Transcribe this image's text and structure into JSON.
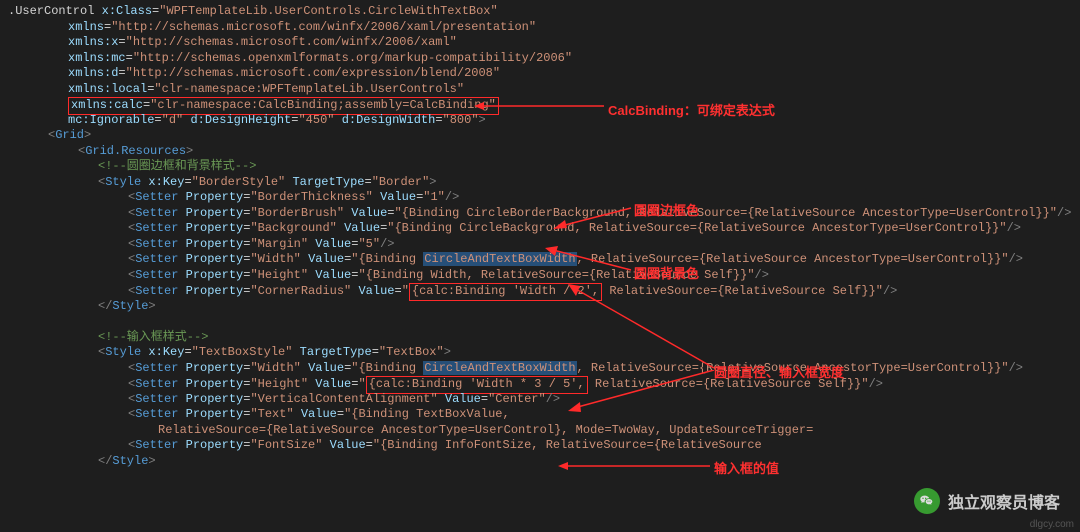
{
  "ann": {
    "calc": "CalcBinding：可绑定表达式",
    "borderColor": "圆圈边框色",
    "bgColor": "圆圈背景色",
    "diamWidth": "圆圈直径、输入框宽度",
    "tbValue": "输入框的值"
  },
  "watermark": "独立观察员博客",
  "dlgcy": "dlgcy.com",
  "c": {
    "l1a": ".UserControl",
    "l1b": "x:Class",
    "l1c": "\"WPFTemplateLib.UserControls.CircleWithTextBox\"",
    "l2a": "xmlns",
    "l2b": "\"http://schemas.microsoft.com/winfx/2006/xaml/presentation\"",
    "l3a": "xmlns:x",
    "l3b": "\"http://schemas.microsoft.com/winfx/2006/xaml\"",
    "l4a": "xmlns:mc",
    "l4b": "\"http://schemas.openxmlformats.org/markup-compatibility/2006\"",
    "l5a": "xmlns:d",
    "l5b": "\"http://schemas.microsoft.com/expression/blend/2008\"",
    "l6a": "xmlns:local",
    "l6b": "\"clr-namespace:WPFTemplateLib.UserControls\"",
    "l7a": "xmlns:calc",
    "l7b": "\"clr-namespace:CalcBinding;assembly=CalcBinding\"",
    "l8a": "mc:Ignorable",
    "l8b": "\"d\"",
    "l8c": "d:DesignHeight",
    "l8d": "\"450\"",
    "l8e": "d:DesignWidth",
    "l8f": "\"800\"",
    "gridO": "Grid",
    "gridRes": "Grid.Resources",
    "cmt1": "<!--圆圈边框和背景样式-->",
    "styleTag": "Style",
    "xKey": "x:Key",
    "bs": "\"BorderStyle\"",
    "tt": "TargetType",
    "border": "\"Border\"",
    "setter": "Setter",
    "prop": "Property",
    "val": "Value",
    "p1": "\"BorderThickness\"",
    "v1": "\"1\"",
    "p2": "\"BorderBrush\"",
    "v2": "\"{Binding CircleBorderBackground, RelativeSource={RelativeSource AncestorType=UserControl}}\"",
    "p3": "\"Background\"",
    "v3": "\"{Binding CircleBackground, RelativeSource={RelativeSource AncestorType=UserControl}}\"",
    "p4": "\"Margin\"",
    "v4": "\"5\"",
    "p5": "\"Width\"",
    "v5a": "\"{Binding ",
    "v5b": "CircleAndTextBoxWidth",
    "v5c": ", RelativeSource={RelativeSource AncestorType=UserControl}}\"",
    "p6": "\"Height\"",
    "v6": "\"{Binding Width, RelativeSource={RelativeSource Self}}\"",
    "p7": "\"CornerRadius\"",
    "v7a": "\"",
    "v7b": "{calc:Binding 'Width / 2',",
    "v7c": " RelativeSource={RelativeSource Self}}\"",
    "cmt2": "<!--输入框样式-->",
    "tbs": "\"TextBoxStyle\"",
    "tb": "\"TextBox\"",
    "q1": "\"Width\"",
    "q1v": "\"{Binding ",
    "q1b": "CircleAndTextBoxWidth",
    "q1c": ", RelativeSource={RelativeSource AncestorType=UserControl}}\"",
    "q2": "\"Height\"",
    "q2a": "\"",
    "q2b": "{calc:Binding 'Width * 3 / 5',",
    "q2c": " RelativeSource={RelativeSource Self}}\"",
    "q3": "\"VerticalContentAlignment\"",
    "q3v": "\"Center\"",
    "q4": "\"Text\"",
    "q4v": "\"{Binding TextBoxValue,",
    "q4v2a": "RelativeSource={RelativeSource AncestorType=UserControl}, Mode=TwoWay, UpdateSourceTrigger=",
    "q5": "\"FontSize\"",
    "q5v": "\"{Binding InfoFontSize, RelativeSource={RelativeSource ",
    "styleClose": "Style"
  }
}
